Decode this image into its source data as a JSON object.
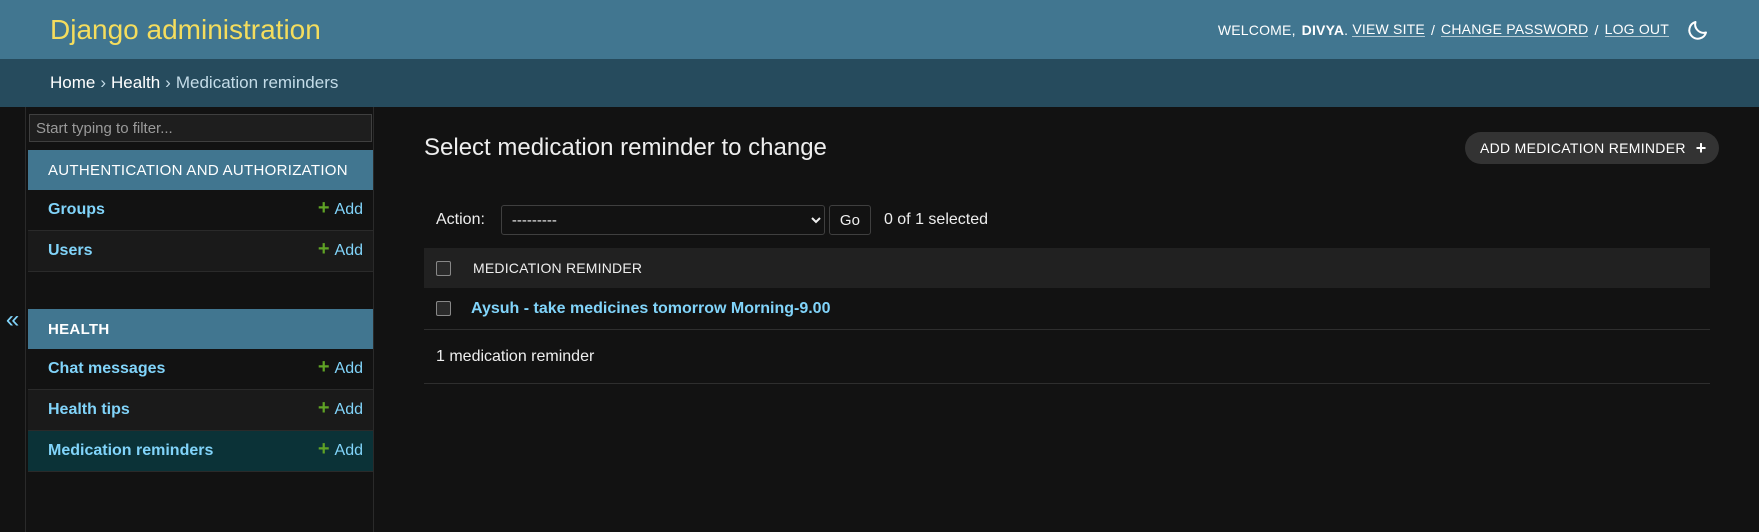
{
  "header": {
    "site_name": "Django administration",
    "welcome": "WELCOME,",
    "username": "DIVYA",
    "links": {
      "view_site": "VIEW SITE",
      "change_password": "CHANGE PASSWORD",
      "log_out": "LOG OUT"
    },
    "separator": "/",
    "theme_icon": "moon-icon"
  },
  "breadcrumbs": {
    "home": "Home",
    "app": "Health",
    "current": "Medication reminders",
    "separator": "›"
  },
  "sidebar": {
    "filter_placeholder": "Start typing to filter...",
    "toggle_label": "«",
    "modules": [
      {
        "caption": "AUTHENTICATION AND AUTHORIZATION",
        "models": [
          {
            "name": "Groups",
            "add": "Add"
          },
          {
            "name": "Users",
            "add": "Add"
          }
        ]
      },
      {
        "caption": "HEALTH",
        "models": [
          {
            "name": "Chat messages",
            "add": "Add"
          },
          {
            "name": "Health tips",
            "add": "Add"
          },
          {
            "name": "Medication reminders",
            "add": "Add",
            "current": true
          }
        ]
      }
    ]
  },
  "content": {
    "title": "Select medication reminder to change",
    "add_button": "ADD MEDICATION REMINDER",
    "actions": {
      "label": "Action:",
      "selected_option": "---------",
      "go": "Go",
      "counter": "0 of 1 selected"
    },
    "table": {
      "column_header": "MEDICATION REMINDER",
      "rows": [
        {
          "label": "Aysuh - take medicines tomorrow Morning-9.00"
        }
      ]
    },
    "paginator": "1 medication reminder"
  },
  "colors": {
    "header_bg": "#417690",
    "branding": "#f5dd5d",
    "breadcrumbs_bg": "#264b5d",
    "link": "#81d4fa",
    "add_plus": "#5fa225",
    "current_row_bg": "#0b3237",
    "body_bg": "#121212"
  }
}
